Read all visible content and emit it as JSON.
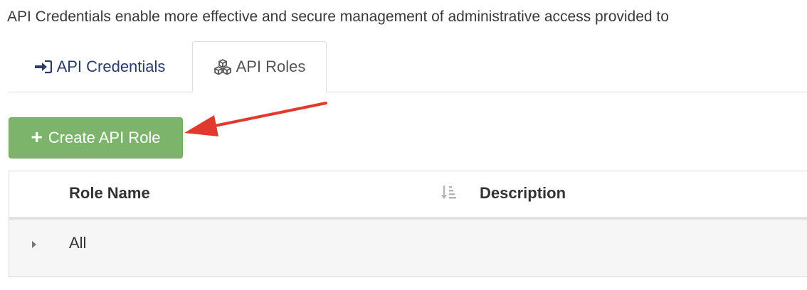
{
  "intro": {
    "text": "API Credentials enable more effective and secure management of administrative access provided to"
  },
  "tabs": [
    {
      "label": "API Credentials",
      "icon": "sign-in-icon",
      "active": false
    },
    {
      "label": "API Roles",
      "icon": "cubes-icon",
      "active": true
    }
  ],
  "toolbar": {
    "create_label": "Create API Role",
    "create_icon": "plus-icon"
  },
  "annotation": {
    "arrow_color": "#e03a2f"
  },
  "grid": {
    "columns": [
      "Role Name",
      "Description"
    ],
    "sort_icon": "sort-amount-down-icon",
    "rows": [
      {
        "name": "All",
        "description": ""
      }
    ]
  },
  "colors": {
    "button_green": "#7db46c",
    "tab_text": "#2b3a67",
    "border": "#dddddd",
    "row_bg": "#f6f6f6"
  }
}
